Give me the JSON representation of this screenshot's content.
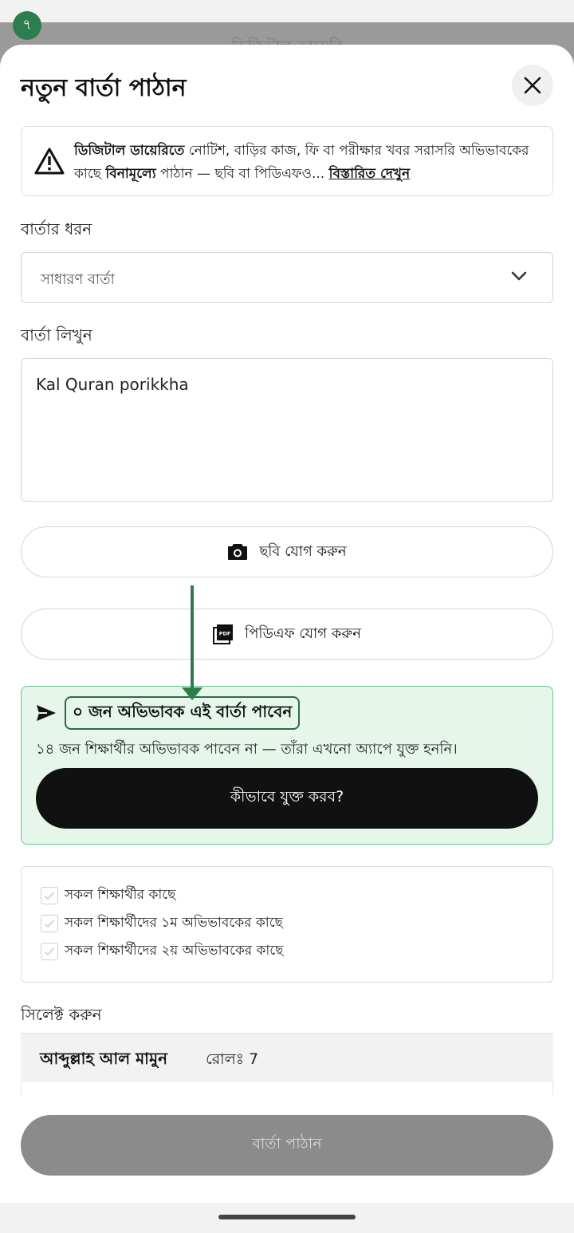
{
  "status": {
    "badge": "৭"
  },
  "backdrop": {
    "text": "ডিজিটাল ডায়েরি"
  },
  "sheet": {
    "title": "নতুন বার্তা পাঠান",
    "close_icon": "close-icon"
  },
  "info": {
    "bold_lead": "ডিজিটাল ডায়েরিতে",
    "text_1": " নোটিশ, বাড়ির কাজ, ফি বা পরীক্ষার খবর সরাসরি অভিভাবকের কাছে ",
    "bold_mid": "বিনামূল্যে",
    "text_2": " পাঠান — ছবি বা পিডিএফও... ",
    "link": "বিস্তারিত দেখুন"
  },
  "message_type": {
    "label": "বার্তার ধরন",
    "value": "সাধারণ বার্তা"
  },
  "message_body": {
    "label": "বার্তা লিখুন",
    "value": "Kal Quran porikkha"
  },
  "attachments": {
    "photo_label": "ছবি যোগ করুন",
    "pdf_label": "পিডিএফ যোগ করুন"
  },
  "recipients": {
    "headline": "০ জন অভিভাবক এই বার্তা পাবেন",
    "subtext": "১৪ জন শিক্ষার্থীর অভিভাবক পাবেন না — তাঁরা এখনো অ্যাপে যুক্ত হননি।",
    "help_button": "কীভাবে যুক্ত করব?"
  },
  "audience_options": [
    {
      "label": "সকল শিক্ষার্থীর কাছে"
    },
    {
      "label": "সকল শিক্ষার্থীদের ১ম অভিভাবকের কাছে"
    },
    {
      "label": "সকল শিক্ষার্থীদের ২য় অভিভাবকের কাছে"
    }
  ],
  "select_section": {
    "label": "সিলেক্ট করুন",
    "students": [
      {
        "name": "আব্দুল্লাহ আল মামুন",
        "roll": "রোলঃ 7"
      }
    ]
  },
  "send_button": "বার্তা পাঠান",
  "colors": {
    "accent_green": "#2e7d4f",
    "card_bg": "#e6f6ea",
    "disabled_btn": "#8b8b8b"
  }
}
